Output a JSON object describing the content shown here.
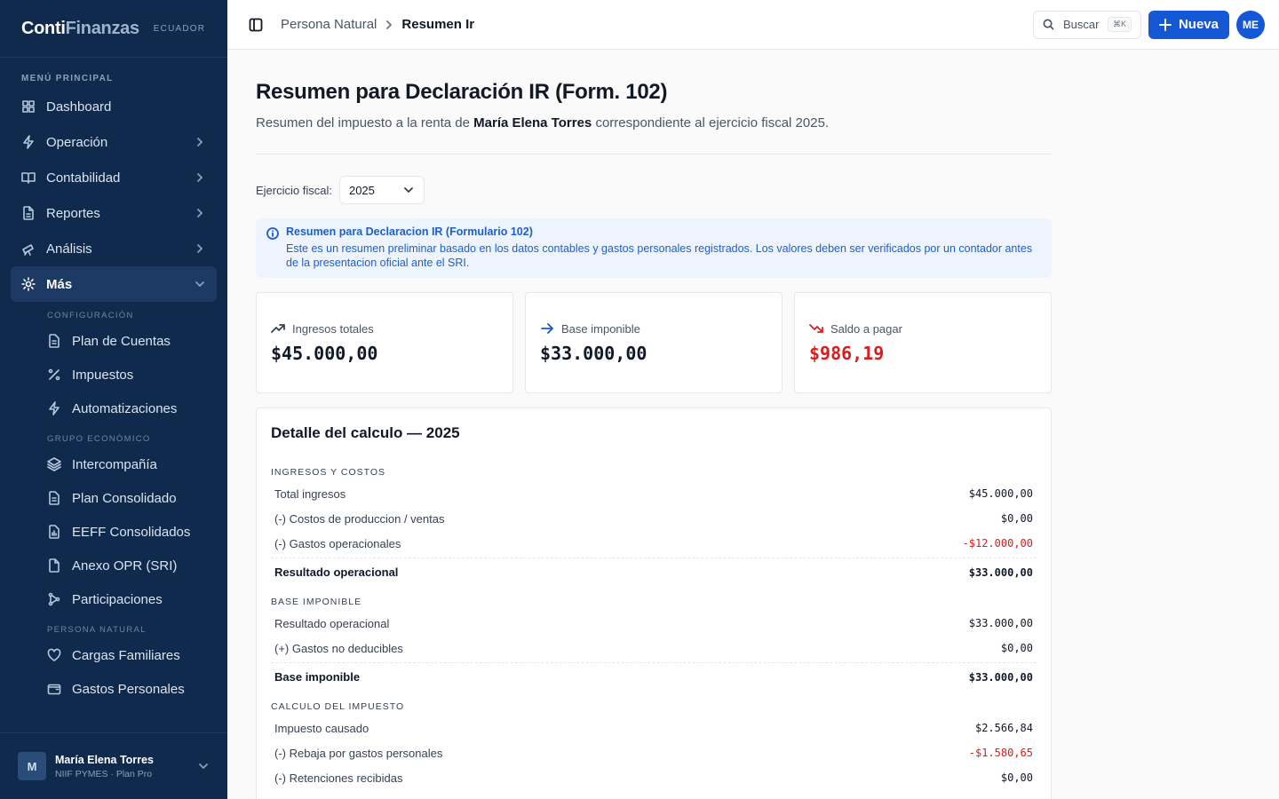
{
  "brand": {
    "name_a": "Conti",
    "name_b": "Finanzas",
    "tag": "ECUADOR"
  },
  "sidebar": {
    "section": "MENÚ PRINCIPAL",
    "items": [
      {
        "label": "Dashboard",
        "icon": "grid-icon"
      },
      {
        "label": "Operación",
        "icon": "bolt-icon"
      },
      {
        "label": "Contabilidad",
        "icon": "book-icon"
      },
      {
        "label": "Reportes",
        "icon": "file-icon"
      },
      {
        "label": "Análisis",
        "icon": "telescope-icon"
      },
      {
        "label": "Más",
        "icon": "gear-icon"
      }
    ],
    "groups": [
      {
        "title": "CONFIGURACIÓN",
        "items": [
          "Plan de Cuentas",
          "Impuestos",
          "Automatizaciones"
        ]
      },
      {
        "title": "GRUPO ECONÓMICO",
        "items": [
          "Intercompañía",
          "Plan Consolidado",
          "EEFF Consolidados",
          "Anexo OPR (SRI)",
          "Participaciones"
        ]
      },
      {
        "title": "PERSONA NATURAL",
        "items": [
          "Cargas Familiares",
          "Gastos Personales"
        ]
      }
    ],
    "user": {
      "initial": "M",
      "name": "María Elena Torres",
      "plan": "NIIF PYMES · Plan Pro"
    }
  },
  "topbar": {
    "crumb_parent": "Persona Natural",
    "crumb_current": "Resumen Ir",
    "search_label": "Buscar",
    "search_kbd": "⌘K",
    "new_label": "Nueva",
    "avatar": "ME"
  },
  "page": {
    "title": "Resumen para Declaración IR (Form. 102)",
    "sub_pre": "Resumen del impuesto a la renta de ",
    "sub_name": "María Elena Torres",
    "sub_post": " correspondiente al ejercicio fiscal 2025.",
    "fy_label": "Ejercicio fiscal:",
    "fy_value": "2025",
    "info_title": "Resumen para Declaracion IR (Formulario 102)",
    "info_text": "Este es un resumen preliminar basado en los datos contables y gastos personales registrados. Los valores deben ser verificados por un contador antes de la presentacion oficial ante el SRI."
  },
  "cards": [
    {
      "label": "Ingresos totales",
      "value": "$45.000,00",
      "icon": "trending-up-icon"
    },
    {
      "label": "Base imponible",
      "value": "$33.000,00",
      "icon": "arrow-right-icon"
    },
    {
      "label": "Saldo a pagar",
      "value": "$986,19",
      "icon": "trending-down-icon"
    }
  ],
  "detail": {
    "title": "Detalle del calculo — 2025",
    "sections": [
      {
        "head": "INGRESOS Y COSTOS",
        "rows": [
          {
            "label": "Total ingresos",
            "amount": "$45.000,00"
          },
          {
            "label": "(-) Costos de produccion / ventas",
            "amount": "$0,00"
          },
          {
            "label": "(-) Gastos operacionales",
            "amount": "-$12.000,00"
          }
        ],
        "total": {
          "label": "Resultado operacional",
          "amount": "$33.000,00"
        }
      },
      {
        "head": "BASE IMPONIBLE",
        "rows": [
          {
            "label": "Resultado operacional",
            "amount": "$33.000,00"
          },
          {
            "label": "(+) Gastos no deducibles",
            "amount": "$0,00"
          }
        ],
        "total": {
          "label": "Base imponible",
          "amount": "$33.000,00"
        }
      },
      {
        "head": "CALCULO DEL IMPUESTO",
        "rows": [
          {
            "label": "Impuesto causado",
            "amount": "$2.566,84"
          },
          {
            "label": "(-) Rebaja por gastos personales",
            "amount": "-$1.580,65"
          },
          {
            "label": "(-) Retenciones recibidas",
            "amount": "$0,00"
          }
        ]
      }
    ]
  },
  "colors": {
    "sidebar": "#0f2a4d",
    "accent": "#1558d6",
    "negative": "#dc1c1c"
  }
}
